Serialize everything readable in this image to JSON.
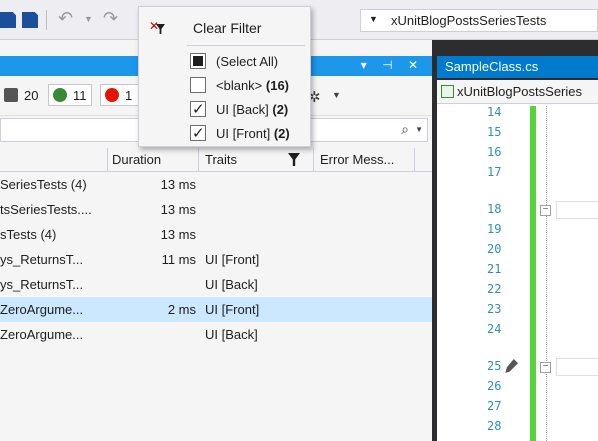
{
  "toolbar": {
    "project_selector": "xUnitBlogPostsSeriesTests"
  },
  "test_explorer": {
    "counts": {
      "total": "20",
      "passed": "11",
      "failed": "1"
    },
    "columns": [
      "Duration",
      "Traits",
      "Error Mess..."
    ],
    "rows": [
      {
        "name": "SeriesTests (4)",
        "duration": "13 ms",
        "traits": ""
      },
      {
        "name": "tsSeriesTests....",
        "duration": "13 ms",
        "traits": ""
      },
      {
        "name": "sTests (4)",
        "duration": "13 ms",
        "traits": ""
      },
      {
        "name": "ys_ReturnsT...",
        "duration": "11 ms",
        "traits": "UI [Front]"
      },
      {
        "name": "ys_ReturnsT...",
        "duration": "",
        "traits": "UI [Back]"
      },
      {
        "name": "ZeroArgume...",
        "duration": "2 ms",
        "traits": "UI [Front]"
      },
      {
        "name": "ZeroArgume...",
        "duration": "",
        "traits": "UI [Back]"
      }
    ]
  },
  "filter_popup": {
    "clear_label": "Clear Filter",
    "options": [
      {
        "label": "(Select All)",
        "count": "",
        "state": "indeterminate"
      },
      {
        "label": "<blank>",
        "count": "(16)",
        "state": "unchecked"
      },
      {
        "label": "UI [Back]",
        "count": "(2)",
        "state": "checked"
      },
      {
        "label": "UI [Front]",
        "count": "(2)",
        "state": "checked"
      }
    ]
  },
  "editor": {
    "tab_label": "SampleClass.cs",
    "nav_text": "xUnitBlogPostsSeries",
    "line_numbers": [
      "14",
      "15",
      "16",
      "17",
      "18",
      "19",
      "20",
      "21",
      "22",
      "23",
      "24",
      "25",
      "26",
      "27",
      "28"
    ]
  }
}
